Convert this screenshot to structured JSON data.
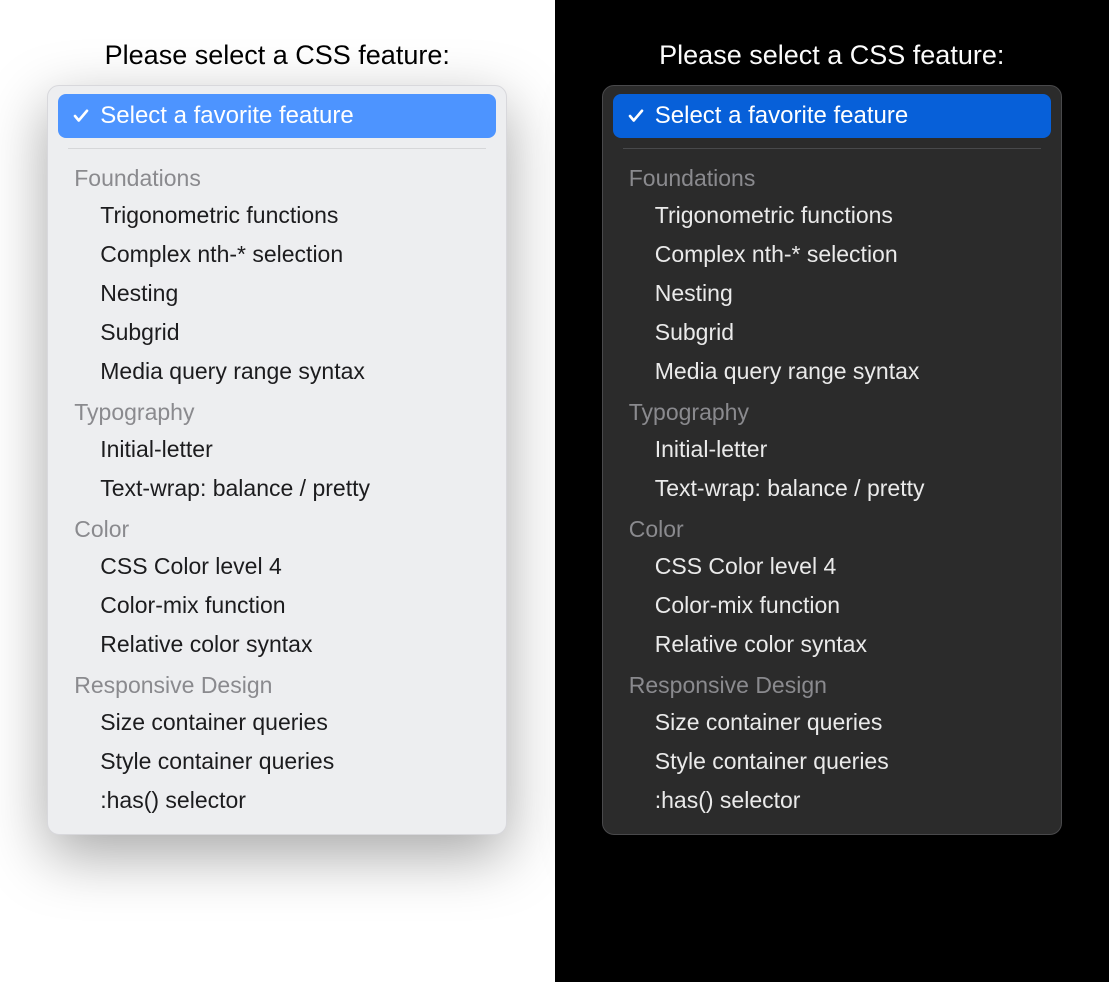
{
  "prompt_text": "Please select a CSS feature:",
  "selected_label": "Select a favorite feature",
  "colors": {
    "light_accent": "#4d94ff",
    "dark_accent": "#0760d9"
  },
  "groups": [
    {
      "label": "Foundations",
      "options": [
        "Trigonometric functions",
        "Complex nth-* selection",
        "Nesting",
        "Subgrid",
        "Media query range syntax"
      ]
    },
    {
      "label": "Typography",
      "options": [
        "Initial-letter",
        "Text-wrap: balance / pretty"
      ]
    },
    {
      "label": "Color",
      "options": [
        "CSS Color level 4",
        "Color-mix function",
        "Relative color syntax"
      ]
    },
    {
      "label": "Responsive Design",
      "options": [
        "Size container queries",
        "Style container queries",
        ":has() selector"
      ]
    }
  ]
}
